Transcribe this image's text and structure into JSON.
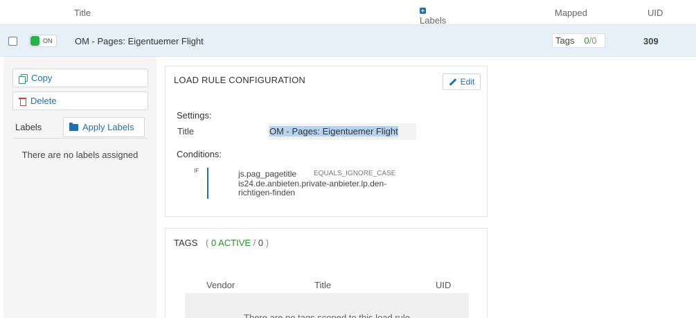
{
  "header": {
    "title_col": "Title",
    "labels_col": "Labels",
    "mapped_col": "Mapped",
    "uid_col": "UID"
  },
  "row": {
    "toggle_label": "ON",
    "title": "OM - Pages: Eigentuemer Flight",
    "tags_label": "Tags",
    "tags_active": "0",
    "tags_sep": "/",
    "tags_total": "0",
    "uid": "309"
  },
  "sidebar": {
    "copy_label": "Copy",
    "delete_label": "Delete",
    "labels_label": "Labels",
    "apply_labels_label": "Apply Labels",
    "no_labels_text": "There are no labels assigned"
  },
  "load_rule": {
    "heading": "LOAD RULE CONFIGURATION",
    "edit_label": "Edit",
    "settings_label": "Settings:",
    "title_label": "Title",
    "title_value": "OM - Pages: Eigentuemer Flight",
    "conditions_label": "Conditions:",
    "if_label": "IF",
    "condition_variable": "js.pag_pagetitle",
    "condition_operator": "EQUALS_IGNORE_CASE",
    "condition_value": "is24.de.anbieten.private-anbieter.lp.den-richtigen-finden"
  },
  "tags_section": {
    "heading": "TAGS",
    "paren_open": "(",
    "active_text": "0 ACTIVE",
    "slash": "/",
    "total": "0",
    "paren_close": ")",
    "col_vendor": "Vendor",
    "col_title": "Title",
    "col_uid": "UID",
    "empty_text": "There are no tags scoped to this load rule"
  },
  "colors": {
    "accent": "#1f6fb2",
    "on_green": "#2ab24a",
    "active_green": "#2c8f2c",
    "delete_red": "#d93838",
    "row_selected": "#e6f0f9",
    "selection_highlight": "#b7d3f0"
  },
  "icons": [
    "plus-icon",
    "copy-icon",
    "trash-icon",
    "folder-icon",
    "pencil-icon"
  ]
}
